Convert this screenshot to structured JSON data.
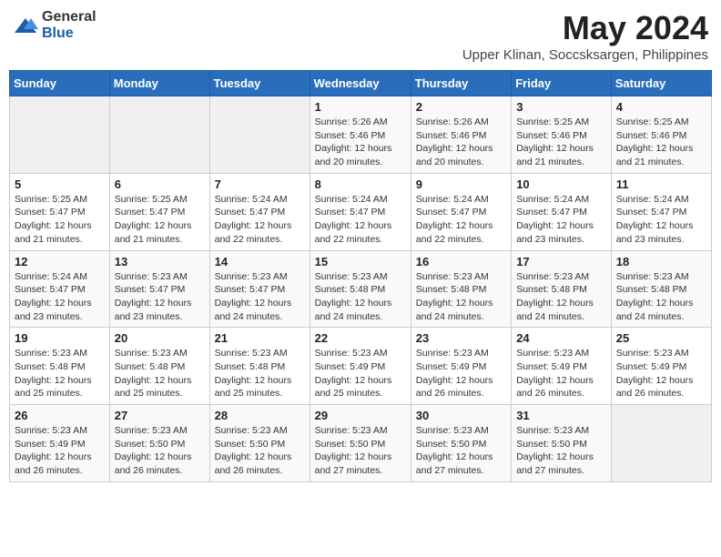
{
  "logo": {
    "general": "General",
    "blue": "Blue"
  },
  "title": "May 2024",
  "subtitle": "Upper Klinan, Soccsksargen, Philippines",
  "days_of_week": [
    "Sunday",
    "Monday",
    "Tuesday",
    "Wednesday",
    "Thursday",
    "Friday",
    "Saturday"
  ],
  "weeks": [
    [
      {
        "day": "",
        "info": ""
      },
      {
        "day": "",
        "info": ""
      },
      {
        "day": "",
        "info": ""
      },
      {
        "day": "1",
        "info": "Sunrise: 5:26 AM\nSunset: 5:46 PM\nDaylight: 12 hours and 20 minutes."
      },
      {
        "day": "2",
        "info": "Sunrise: 5:26 AM\nSunset: 5:46 PM\nDaylight: 12 hours and 20 minutes."
      },
      {
        "day": "3",
        "info": "Sunrise: 5:25 AM\nSunset: 5:46 PM\nDaylight: 12 hours and 21 minutes."
      },
      {
        "day": "4",
        "info": "Sunrise: 5:25 AM\nSunset: 5:46 PM\nDaylight: 12 hours and 21 minutes."
      }
    ],
    [
      {
        "day": "5",
        "info": "Sunrise: 5:25 AM\nSunset: 5:47 PM\nDaylight: 12 hours and 21 minutes."
      },
      {
        "day": "6",
        "info": "Sunrise: 5:25 AM\nSunset: 5:47 PM\nDaylight: 12 hours and 21 minutes."
      },
      {
        "day": "7",
        "info": "Sunrise: 5:24 AM\nSunset: 5:47 PM\nDaylight: 12 hours and 22 minutes."
      },
      {
        "day": "8",
        "info": "Sunrise: 5:24 AM\nSunset: 5:47 PM\nDaylight: 12 hours and 22 minutes."
      },
      {
        "day": "9",
        "info": "Sunrise: 5:24 AM\nSunset: 5:47 PM\nDaylight: 12 hours and 22 minutes."
      },
      {
        "day": "10",
        "info": "Sunrise: 5:24 AM\nSunset: 5:47 PM\nDaylight: 12 hours and 23 minutes."
      },
      {
        "day": "11",
        "info": "Sunrise: 5:24 AM\nSunset: 5:47 PM\nDaylight: 12 hours and 23 minutes."
      }
    ],
    [
      {
        "day": "12",
        "info": "Sunrise: 5:24 AM\nSunset: 5:47 PM\nDaylight: 12 hours and 23 minutes."
      },
      {
        "day": "13",
        "info": "Sunrise: 5:23 AM\nSunset: 5:47 PM\nDaylight: 12 hours and 23 minutes."
      },
      {
        "day": "14",
        "info": "Sunrise: 5:23 AM\nSunset: 5:47 PM\nDaylight: 12 hours and 24 minutes."
      },
      {
        "day": "15",
        "info": "Sunrise: 5:23 AM\nSunset: 5:48 PM\nDaylight: 12 hours and 24 minutes."
      },
      {
        "day": "16",
        "info": "Sunrise: 5:23 AM\nSunset: 5:48 PM\nDaylight: 12 hours and 24 minutes."
      },
      {
        "day": "17",
        "info": "Sunrise: 5:23 AM\nSunset: 5:48 PM\nDaylight: 12 hours and 24 minutes."
      },
      {
        "day": "18",
        "info": "Sunrise: 5:23 AM\nSunset: 5:48 PM\nDaylight: 12 hours and 24 minutes."
      }
    ],
    [
      {
        "day": "19",
        "info": "Sunrise: 5:23 AM\nSunset: 5:48 PM\nDaylight: 12 hours and 25 minutes."
      },
      {
        "day": "20",
        "info": "Sunrise: 5:23 AM\nSunset: 5:48 PM\nDaylight: 12 hours and 25 minutes."
      },
      {
        "day": "21",
        "info": "Sunrise: 5:23 AM\nSunset: 5:48 PM\nDaylight: 12 hours and 25 minutes."
      },
      {
        "day": "22",
        "info": "Sunrise: 5:23 AM\nSunset: 5:49 PM\nDaylight: 12 hours and 25 minutes."
      },
      {
        "day": "23",
        "info": "Sunrise: 5:23 AM\nSunset: 5:49 PM\nDaylight: 12 hours and 26 minutes."
      },
      {
        "day": "24",
        "info": "Sunrise: 5:23 AM\nSunset: 5:49 PM\nDaylight: 12 hours and 26 minutes."
      },
      {
        "day": "25",
        "info": "Sunrise: 5:23 AM\nSunset: 5:49 PM\nDaylight: 12 hours and 26 minutes."
      }
    ],
    [
      {
        "day": "26",
        "info": "Sunrise: 5:23 AM\nSunset: 5:49 PM\nDaylight: 12 hours and 26 minutes."
      },
      {
        "day": "27",
        "info": "Sunrise: 5:23 AM\nSunset: 5:50 PM\nDaylight: 12 hours and 26 minutes."
      },
      {
        "day": "28",
        "info": "Sunrise: 5:23 AM\nSunset: 5:50 PM\nDaylight: 12 hours and 26 minutes."
      },
      {
        "day": "29",
        "info": "Sunrise: 5:23 AM\nSunset: 5:50 PM\nDaylight: 12 hours and 27 minutes."
      },
      {
        "day": "30",
        "info": "Sunrise: 5:23 AM\nSunset: 5:50 PM\nDaylight: 12 hours and 27 minutes."
      },
      {
        "day": "31",
        "info": "Sunrise: 5:23 AM\nSunset: 5:50 PM\nDaylight: 12 hours and 27 minutes."
      },
      {
        "day": "",
        "info": ""
      }
    ]
  ]
}
